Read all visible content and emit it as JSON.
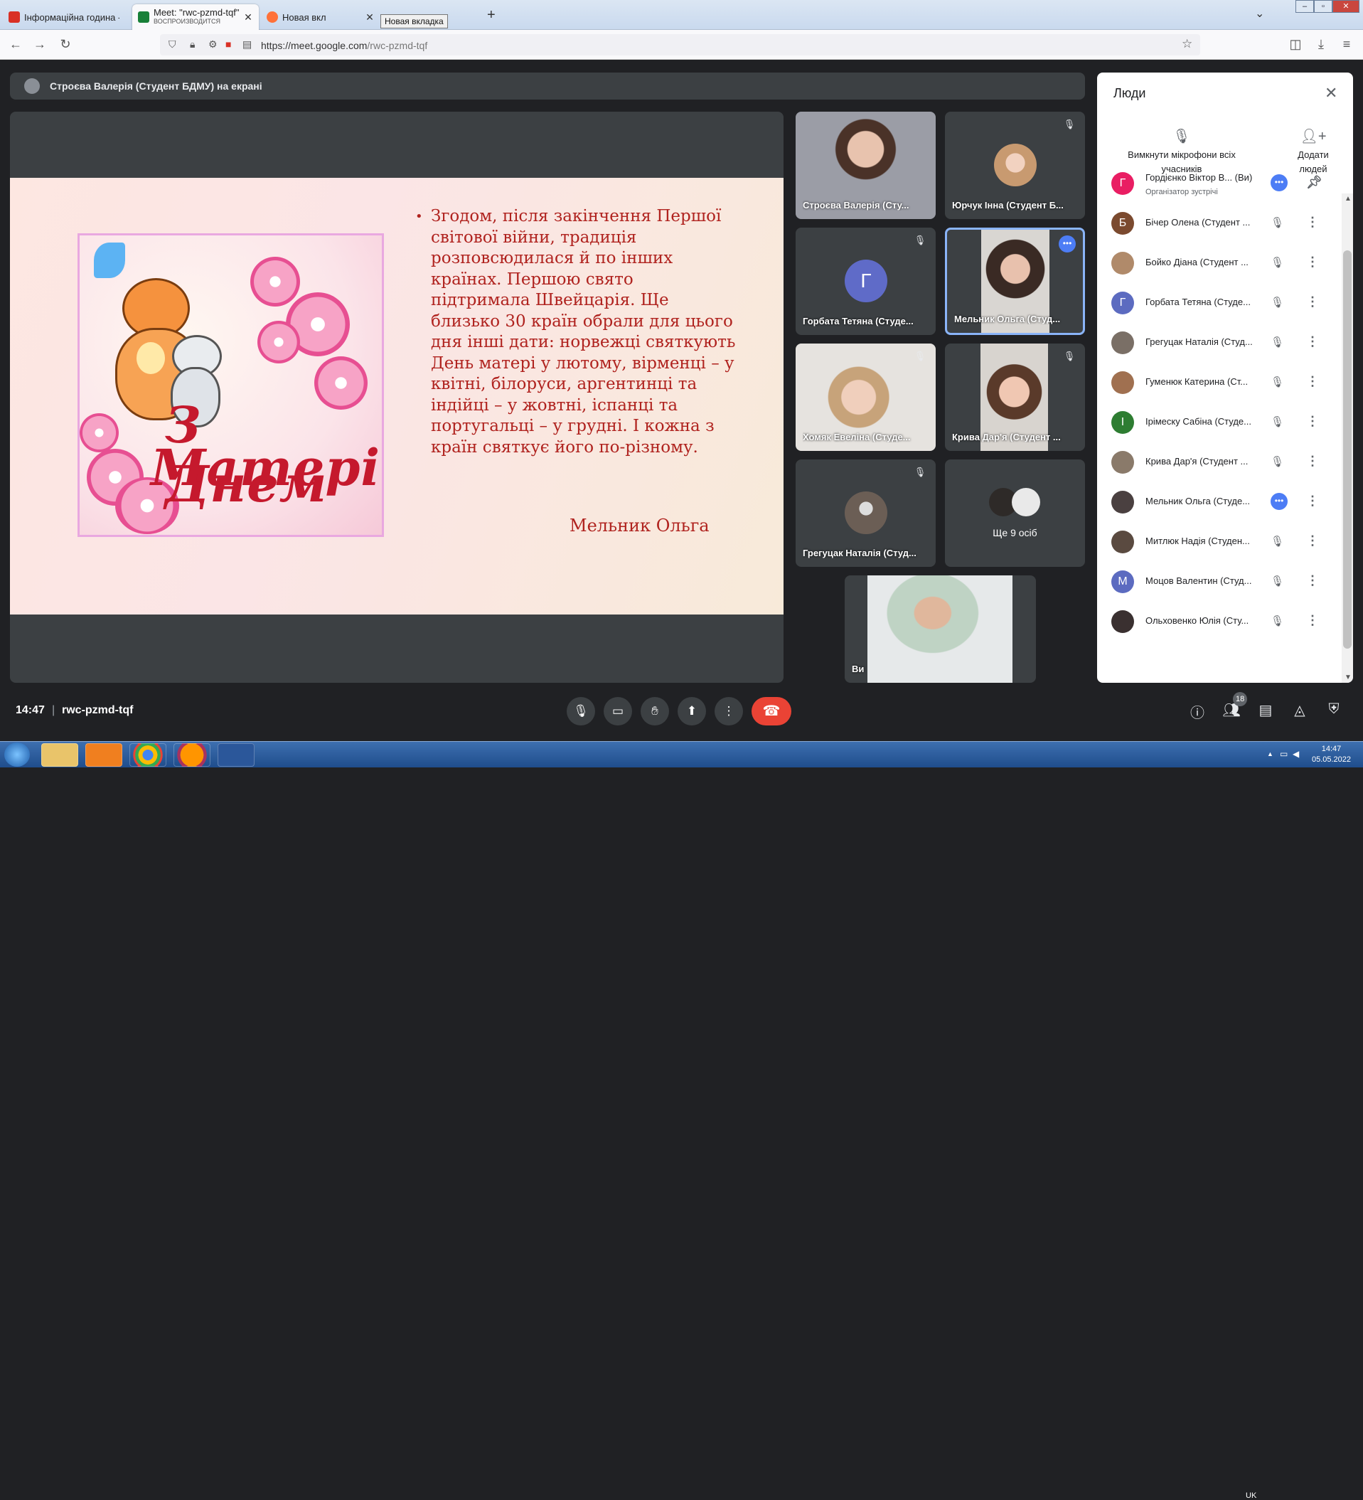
{
  "browser": {
    "tabs": [
      {
        "title": "Інформаційна година - gordie",
        "favicon_color": "#d93025"
      },
      {
        "title": "Meet: \"rwc-pzmd-tqf\"",
        "subtitle": "ВОСПРОИЗВОДИТСЯ",
        "favicon_color": "#188038"
      },
      {
        "title": "Новая вкл",
        "favicon_color": "#ff7139"
      }
    ],
    "tooltip": "Новая вкладка",
    "new_tab": "+",
    "url_host": "https://meet.google.com",
    "url_path": "/rwc-pzmd-tqf"
  },
  "meet": {
    "presenter_banner": "Строєва Валерія (Студент БДМУ) на екрані",
    "slide": {
      "bullet": "•",
      "text": "Згодом, після закінчення Першої світової війни, традиція розповсюдилася й по інших країнах. Першою свято підтримала Швейцарія. Ще близько 30 країн обрали для цього дня інші дати: норвежці святкують День матері у лютому, вірменці – у квітні, білоруси, аргентинці та індійці – у жовтні, іспанці та португальці – у грудні. І кожна з країн святкує його по-різному.",
      "signature": "Мельник Ольга",
      "card_line1": "З Днем",
      "card_line2": "Матері!"
    },
    "tiles": [
      {
        "name": "Строєва Валерія (Сту...",
        "type": "video",
        "muted": false
      },
      {
        "name": "Юрчук Інна (Студент Б...",
        "type": "avatar",
        "muted": true
      },
      {
        "name": "Горбата Тетяна (Студе...",
        "type": "letter",
        "letter": "Г",
        "muted": true
      },
      {
        "name": "Мельник Ольга (Студ...",
        "type": "video",
        "muted": false,
        "active": true
      },
      {
        "name": "Хомяк Евеліна (Студе...",
        "type": "video",
        "muted": true
      },
      {
        "name": "Крива Дар'я (Студент ...",
        "type": "video",
        "muted": true
      },
      {
        "name": "Грегуцак Наталія (Студ...",
        "type": "avatar",
        "muted": true
      },
      {
        "name": "Ще 9 осіб",
        "type": "more"
      }
    ],
    "self_tile_name": "Ви",
    "time": "14:47",
    "meeting_code": "rwc-pzmd-tqf",
    "participants_count": "18"
  },
  "people_panel": {
    "title": "Люди",
    "mute_all_label": "Вимкнути мікрофони всіх учасників",
    "add_people_label": "Додати людей",
    "participants": [
      {
        "name": "Гордієнко Віктор В... (Ви)",
        "sub": "Організатор зустрічі",
        "initial": "Г",
        "color": "#e91e63",
        "state": "speaking",
        "pin": true
      },
      {
        "name": "Бічер Олена (Студент ...",
        "initial": "Б",
        "color": "#7b4a2f",
        "state": "muted"
      },
      {
        "name": "Бойко Діана (Студент ...",
        "initial": "",
        "color": "#b08a6a",
        "state": "muted"
      },
      {
        "name": "Горбата Тетяна (Студе...",
        "initial": "Г",
        "color": "#5c6bc0",
        "state": "muted"
      },
      {
        "name": "Грегуцак Наталія (Студ...",
        "initial": "",
        "color": "#7a6f66",
        "state": "muted"
      },
      {
        "name": "Гуменюк Катерина (Ст...",
        "initial": "",
        "color": "#a07050",
        "state": "muted"
      },
      {
        "name": "Ірімеску Сабіна (Студе...",
        "initial": "І",
        "color": "#2e7d32",
        "state": "muted"
      },
      {
        "name": "Крива Дар'я (Студент ...",
        "initial": "",
        "color": "#8a7a6a",
        "state": "muted"
      },
      {
        "name": "Мельник Ольга (Студе...",
        "initial": "",
        "color": "#4a4040",
        "state": "speaking"
      },
      {
        "name": "Митлюк Надія (Студен...",
        "initial": "",
        "color": "#5a4a40",
        "state": "muted"
      },
      {
        "name": "Моцов Валентин (Студ...",
        "initial": "М",
        "color": "#5c6bc0",
        "state": "muted"
      },
      {
        "name": "Ольховенко Юлія (Сту...",
        "initial": "",
        "color": "#3a3030",
        "state": "muted"
      }
    ]
  },
  "taskbar": {
    "lang": "UK",
    "clock_time": "14:47",
    "clock_date": "05.05.2022"
  }
}
